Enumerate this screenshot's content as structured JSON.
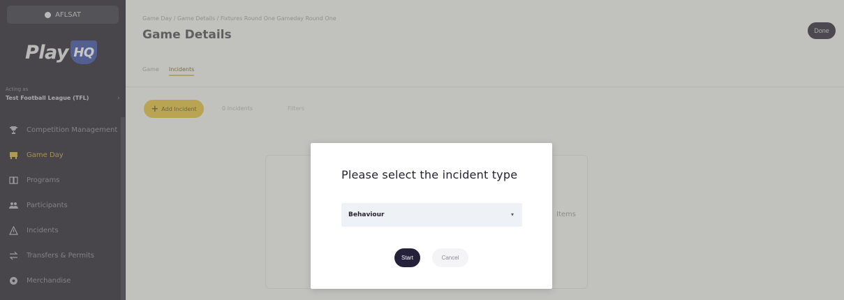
{
  "sidebar": {
    "top_badge": "AFLSAT",
    "logo_text": "Play",
    "logo_badge": "HQ",
    "org_label": "Acting as",
    "org_name": "Test Football League (TFL)",
    "items": [
      {
        "label": "Competition Management",
        "icon": "trophy-icon"
      },
      {
        "label": "Game Day",
        "icon": "game-day-icon"
      },
      {
        "label": "Programs",
        "icon": "programs-icon"
      },
      {
        "label": "Participants",
        "icon": "participants-icon"
      },
      {
        "label": "Incidents",
        "icon": "warning-icon"
      },
      {
        "label": "Transfers & Permits",
        "icon": "transfer-icon"
      },
      {
        "label": "Merchandise",
        "icon": "merchandise-icon"
      }
    ]
  },
  "header": {
    "breadcrumb": "Game Day / Game Details / Fixtures Round One Gameday Round One",
    "title": "Game Details",
    "done_label": "Done"
  },
  "tabs": [
    {
      "label": "Game"
    },
    {
      "label": "Incidents",
      "active": true
    }
  ],
  "toolbar": {
    "add_label": "Add Incident",
    "filter_label": "0 Incidents",
    "extra_label": "Filters"
  },
  "background": {
    "card_text": "Items"
  },
  "modal": {
    "title": "Please select the incident type",
    "select_value": "Behaviour",
    "start_label": "Start",
    "cancel_label": "Cancel"
  },
  "colors": {
    "sidebar_bg": "#26232f",
    "accent_yellow": "#e8c53e",
    "primary_dark": "#26213a"
  }
}
